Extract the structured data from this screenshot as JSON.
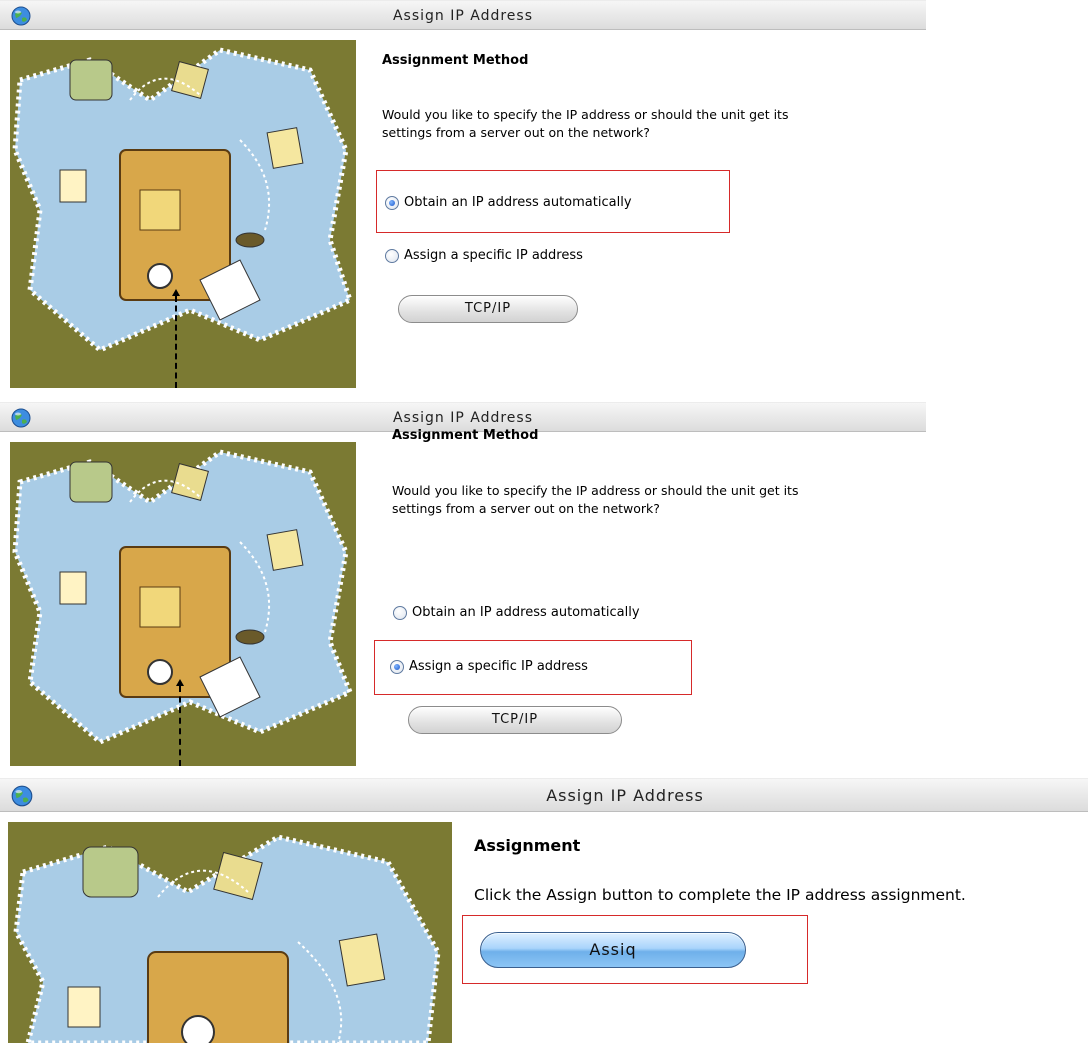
{
  "panels": [
    {
      "title": "Assign IP Address",
      "heading": "Assignment Method",
      "description_line1": "Would you like to specify the IP address or should the unit get its",
      "description_line2": "settings from a server out on the network?",
      "option_auto": "Obtain an IP address automatically",
      "option_specific": "Assign a specific IP address",
      "selected": "auto",
      "button": "TCP/IP"
    },
    {
      "title": "Assign IP Address",
      "heading": "Assignment Method",
      "description_line1": "Would you like to specify the IP address or should the unit get its",
      "description_line2": "settings from a server out on the network?",
      "option_auto": "Obtain an IP address automatically",
      "option_specific": "Assign a specific IP address",
      "selected": "specific",
      "button": "TCP/IP"
    },
    {
      "title": "Assign IP Address",
      "heading": "Assignment",
      "description": "Click the Assign button to complete the IP address assignment.",
      "button": "Assiq"
    }
  ],
  "colors": {
    "art_background": "#7b7a33",
    "highlight": "#d62a2a",
    "radio_selected": "#1a56c9"
  },
  "icons": [
    "globe-icon",
    "radio-icon",
    "arrow-up-icon"
  ]
}
